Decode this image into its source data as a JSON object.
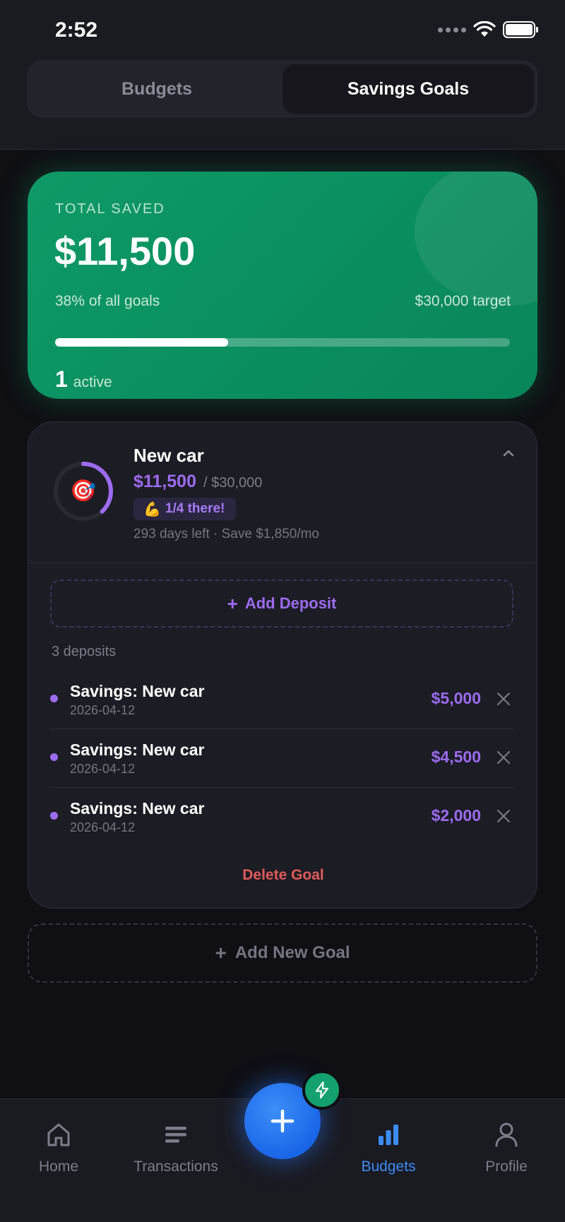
{
  "status_bar": {
    "time": "2:52"
  },
  "segments": {
    "budgets": "Budgets",
    "savings_goals": "Savings Goals",
    "selected": "Savings Goals"
  },
  "summary": {
    "label": "TOTAL SAVED",
    "amount": "$11,500",
    "percent_text": "38% of all goals",
    "progress": 0.38,
    "target_text": "$30,000 target",
    "active_count": "1",
    "active_label": "active"
  },
  "goal": {
    "title": "New car",
    "saved": "$11,500",
    "target": "/ $30,000",
    "progress": 0.38,
    "emoji": "🎯",
    "badge_emoji": "💪",
    "badge_text": "1/4 there!",
    "meta": "293 days left · Save $1,850/mo",
    "add_deposit": "Add Deposit",
    "deposits_count": "3 deposits",
    "deposits": [
      {
        "name": "Savings: New car",
        "date": "2026-04-12",
        "amount": "$5,000"
      },
      {
        "name": "Savings: New car",
        "date": "2026-04-12",
        "amount": "$4,500"
      },
      {
        "name": "Savings: New car",
        "date": "2026-04-12",
        "amount": "$2,000"
      }
    ],
    "delete_label": "Delete Goal"
  },
  "add_goal_label": "Add New Goal",
  "tabs": [
    {
      "label": "Home",
      "icon": "home-icon"
    },
    {
      "label": "Transactions",
      "icon": "list-icon"
    },
    {
      "label": "Budgets",
      "icon": "bar-chart-icon",
      "active": true
    },
    {
      "label": "Profile",
      "icon": "person-icon"
    }
  ],
  "colors": {
    "accent_purple": "#9b6cf0",
    "accent_green": "#0e9a66",
    "accent_blue": "#3b8cf5",
    "danger": "#e05a5a"
  }
}
